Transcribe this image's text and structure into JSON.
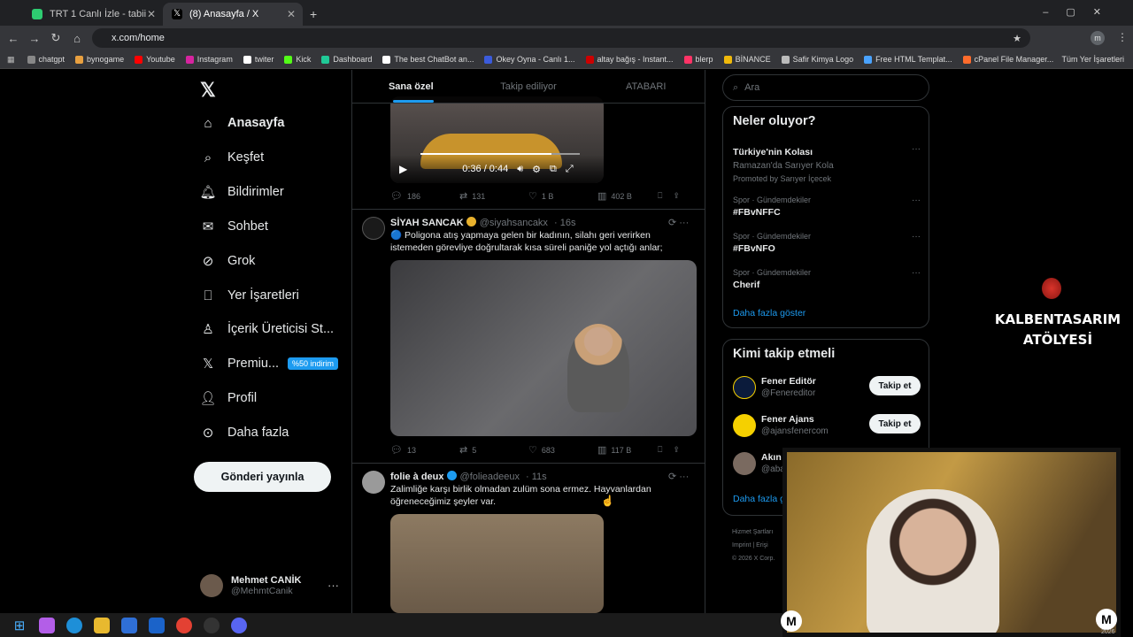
{
  "browser": {
    "tabs": [
      {
        "title": "TRT 1 Canlı İzle - tabii",
        "active": false
      },
      {
        "title": "(8) Anasayfa / X",
        "active": true
      }
    ],
    "url": "x.com/home",
    "bookmarks": [
      "chatgpt",
      "bynogame",
      "Youtube",
      "Instagram",
      "twiter",
      "Kick",
      "Dashboard",
      "The best ChatBot an...",
      "Okey Oyna - Canlı 1...",
      "altay bağış - Instant...",
      "blerp",
      "BİNANCE",
      "Safir Kimya Logo",
      "Free HTML Templat...",
      "cPanel File Manager..."
    ],
    "all_bookmarks": "Tüm Yer İşaretleri",
    "profile_initial": "m"
  },
  "nav": {
    "items": [
      "Anasayfa",
      "Keşfet",
      "Bildirimler",
      "Sohbet",
      "Grok",
      "Yer İşaretleri",
      "İçerik Üreticisi St...",
      "Premiu...",
      "Profil",
      "Daha fazla"
    ],
    "premium_badge": "%50 indirim",
    "post_button": "Gönderi yayınla",
    "user_name": "Mehmet CANİK",
    "user_handle": "@MehmtCanik"
  },
  "feed": {
    "tabs": [
      "Sana özel",
      "Takip ediliyor",
      "ATABARI"
    ],
    "video_time": "0:36 / 0:44",
    "video_progress": 0.82,
    "tweets": [
      {
        "stats": [
          "186",
          "131",
          "1 B",
          "402 B"
        ]
      },
      {
        "name": "SİYAH SANCAK",
        "handle": "@siyahsancakx",
        "time": "· 16s",
        "text": "🔵 Poligona atış yapmaya gelen bir kadının, silahı geri verirken istemeden görevliye doğrultarak kısa süreli paniğe yol açtığı anlar;",
        "stats": [
          "13",
          "5",
          "683",
          "117 B"
        ]
      },
      {
        "name": "folie à deux",
        "handle": "@folieadeeux",
        "time": "· 11s",
        "text": "Zalimliğe karşı birlik olmadan zulüm sona ermez. Hayvanlardan öğreneceğimiz şeyler var."
      }
    ]
  },
  "right": {
    "search_placeholder": "Ara",
    "trends_title": "Neler oluyor?",
    "trends": [
      {
        "category": "",
        "title": "Türkiye'nin Kolası",
        "sub": "Ramazan'da Sarıyer Kola",
        "promo": "Promoted by Sarıyer İçecek"
      },
      {
        "category": "Spor · Gündemdekiler",
        "title": "#FBvNFFC"
      },
      {
        "category": "Spor · Gündemdekiler",
        "title": "#FBvNFO"
      },
      {
        "category": "Spor · Gündemdekiler",
        "title": "Cherif"
      }
    ],
    "show_more": "Daha fazla göster",
    "follow_title": "Kimi takip etmeli",
    "follow": [
      {
        "name": "Fener Editör",
        "handle": "@Fenereditor",
        "button": "Takip et"
      },
      {
        "name": "Fener Ajans",
        "handle": "@ajansfenercom",
        "button": "Takip et"
      },
      {
        "name": "Akın",
        "handle": "@aba"
      }
    ],
    "follow_more": "Daha fazla g",
    "footer": [
      "Hizmet Şartları",
      "Imprint  |  Erişi",
      "© 2026 X Corp."
    ]
  },
  "overlay": {
    "studio": "KALBENTASARIM ATÖLYESİ",
    "cam_logo": "M",
    "timestamp": "2026"
  },
  "colors": {
    "accent": "#1d9bf0",
    "background": "#000000",
    "border": "#2f3336"
  }
}
